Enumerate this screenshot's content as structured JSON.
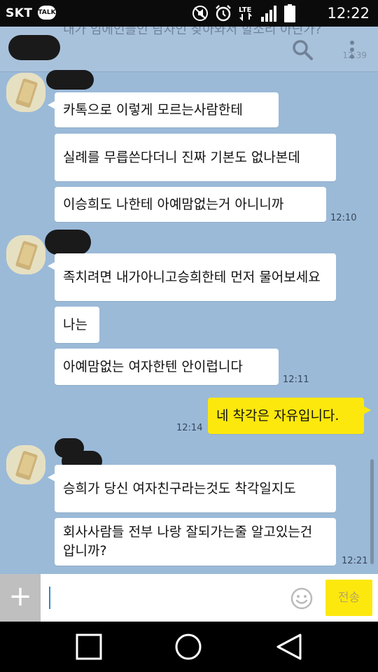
{
  "status_bar": {
    "carrier": "SKT",
    "talk_badge": "TALK",
    "network_label": "LTE",
    "time": "12:22",
    "icons": [
      "talk-notification-icon",
      "mute-icon",
      "alarm-icon",
      "lte-icon",
      "signal-icon",
      "battery-icon"
    ]
  },
  "header": {
    "pinned_text": "내가 임에인들인 담자인 찾아와서 할소리 아닌가?",
    "time": "12:39",
    "icons": [
      "search-icon",
      "more-icon"
    ]
  },
  "messages": [
    {
      "from": "other",
      "text": "카톡으로 이렇게 모르는사람한테"
    },
    {
      "from": "other",
      "text": "실례를 무릅쓴다더니 진짜 기본도 없나본데"
    },
    {
      "from": "other",
      "text": "이승희도 나한테 아예맘없는거 아니니까",
      "time": "12:10"
    },
    {
      "from": "other",
      "text": "족치려면 내가아니고승희한테 먼저 물어보세요"
    },
    {
      "from": "other",
      "text": "나는"
    },
    {
      "from": "other",
      "text": "아예맘없는 여자한텐 안이럽니다",
      "time": "12:11"
    },
    {
      "from": "me",
      "text": "네 착각은 자유입니다.",
      "time": "12:14"
    },
    {
      "from": "other",
      "text": "승희가 당신 여자친구라는것도 착각일지도"
    },
    {
      "from": "other",
      "text": "회사사람들 전부 나랑 잘되가는줄 알고있는건 압니까?",
      "time": "12:21"
    }
  ],
  "input_bar": {
    "plus_label": "+",
    "send_label": "전송",
    "icons": [
      "plus-icon",
      "emoji-icon"
    ]
  },
  "nav_bar": {
    "icons": [
      "recent-apps-icon",
      "home-icon",
      "back-icon"
    ]
  },
  "colors": {
    "chat_background": "#9bbad8",
    "my_bubble": "#fde80d",
    "other_bubble": "#ffffff",
    "send_button": "#fde80d"
  }
}
